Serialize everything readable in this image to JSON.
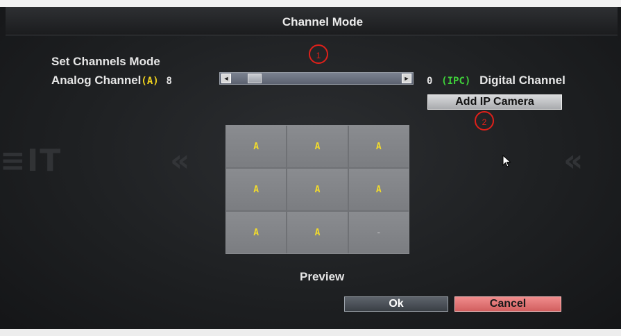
{
  "dialog": {
    "title": "Channel Mode",
    "section_label": "Set Channels Mode",
    "analog_label": "Analog Channel",
    "analog_badge": "(A)",
    "analog_count": "8",
    "digital_count": "0",
    "digital_badge": "(IPC)",
    "digital_label": "Digital Channel",
    "preview_label": "Preview"
  },
  "markers": {
    "one": "1",
    "two": "2"
  },
  "slider": {
    "left_arrow": "◄",
    "right_arrow": "►",
    "position_fraction": 0.1
  },
  "grid": {
    "cells": [
      "A",
      "A",
      "A",
      "A",
      "A",
      "A",
      "A",
      "A",
      "-"
    ]
  },
  "buttons": {
    "add_ip_camera": "Add IP Camera",
    "ok": "Ok",
    "cancel": "Cancel"
  },
  "colors": {
    "analog_accent": "#f0d21e",
    "digital_accent": "#3fd23a",
    "cancel_bg": "#e07474",
    "annotation_red": "#e0201a"
  },
  "icons": {
    "cursor": "mouse-pointer-icon",
    "slider_left": "arrow-left-icon",
    "slider_right": "arrow-right-icon"
  }
}
